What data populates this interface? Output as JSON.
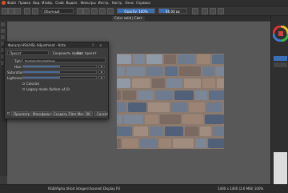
{
  "menubar": {
    "items": [
      "Файл",
      "Правка",
      "Вид",
      "Изобр.",
      "Слой",
      "Выдел.",
      "Фильтры",
      "Инстр.",
      "Настр.",
      "Окно",
      "Справка"
    ]
  },
  "toolbar": {
    "blend_mode": "Обычный",
    "opacity_label": "Opacity: 100%",
    "opacity_fraction": 1.0,
    "size_label": "40.00 px",
    "size_fraction": 0.35
  },
  "tabs": {
    "active": "Сolor solid | Свет"
  },
  "dialog": {
    "title": "Фильтр HSV/HSL Adjustment - Krita",
    "preset_label": "Пресет",
    "save_label": "Сохранить пресет",
    "reset_label": "Вос. пресет",
    "type_label": "Тип:",
    "type_value": "Hue/Saturation/Lightness",
    "hue_label": "Hue:",
    "hue_value": "0",
    "sat_label": "Saturation:",
    "sat_value": "0",
    "light_label": "Lightness:",
    "light_value": "0",
    "colorize_label": "Colorize",
    "legacy_label": "Legacy mode (before v4.0)",
    "btn_preview": "Просмотр",
    "btn_mask": "Маскфильтр",
    "btn_create": "Создать Filter Mask",
    "btn_ok": "OK",
    "btn_cancel": "Cancel"
  },
  "statusbar": {
    "left": "RGB/Alpha (8-bit integer/channel)  Display P3",
    "right": "1400 x 1400 (2.6 MiB)  100%"
  }
}
